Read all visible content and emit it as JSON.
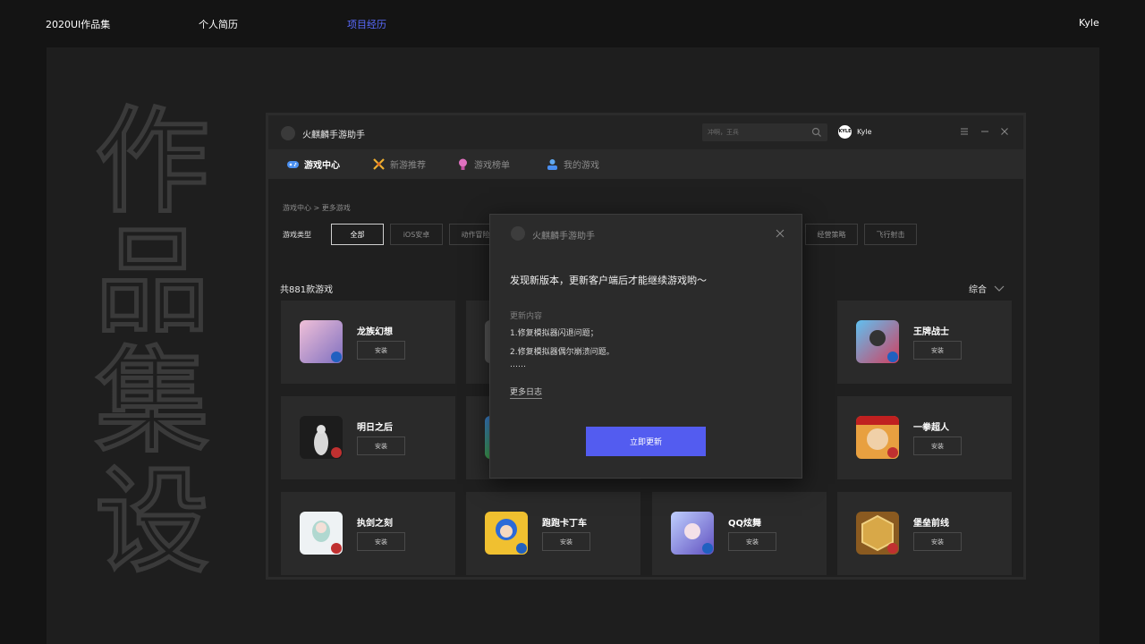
{
  "topnav": {
    "portfolio": "2020UI作品集",
    "resume": "个人简历",
    "projects": "项目经历",
    "user": "Kyle"
  },
  "deco_text": [
    "作",
    "品",
    "集",
    "设"
  ],
  "app": {
    "title": "火麒麟手游助手",
    "search_placeholder": "冲啊，王兵",
    "user_name": "Kyle",
    "avatar_text": "KYLE",
    "tabs": [
      {
        "label": "游戏中心"
      },
      {
        "label": "新游推荐"
      },
      {
        "label": "游戏榜单"
      },
      {
        "label": "我的游戏"
      }
    ],
    "breadcrumb": "游戏中心 > 更多游戏",
    "filter_label": "游戏类型",
    "filters": [
      "全部",
      "iOS安卓",
      "动作冒险",
      "经营策略",
      "飞行射击"
    ],
    "count_text": "共881款游戏",
    "sort_label": "综合",
    "install_label": "安装",
    "games": [
      {
        "name": "龙族幻想",
        "icon_color": "#c8a0d8"
      },
      {
        "name": "王牌战士",
        "icon_color": "#3f6fd0"
      },
      {
        "name": "明日之后",
        "icon_color": "#2c2c2c"
      },
      {
        "name": "一拳超人",
        "icon_color": "#e0a040"
      },
      {
        "name": "执剑之刻",
        "icon_color": "#e8eef0"
      },
      {
        "name": "跑跑卡丁车",
        "icon_color": "#3a7de0"
      },
      {
        "name": "QQ炫舞",
        "icon_color": "#a8b8f0"
      },
      {
        "name": "堡垒前线",
        "icon_color": "#c89030"
      }
    ]
  },
  "modal": {
    "title": "火麒麟手游助手",
    "headline": "发现新版本，更新客户端后才能继续游戏哟～",
    "sub": "更新内容",
    "lines": [
      "1.修复模拟器闪退问题；",
      "2.修复模拟器偶尔崩溃问题。",
      "……"
    ],
    "more": "更多日志",
    "button": "立即更新"
  },
  "colors": {
    "accent": "#5a6bff",
    "button": "#535cf0",
    "background": "#141414",
    "panel": "#1e1e1e"
  }
}
